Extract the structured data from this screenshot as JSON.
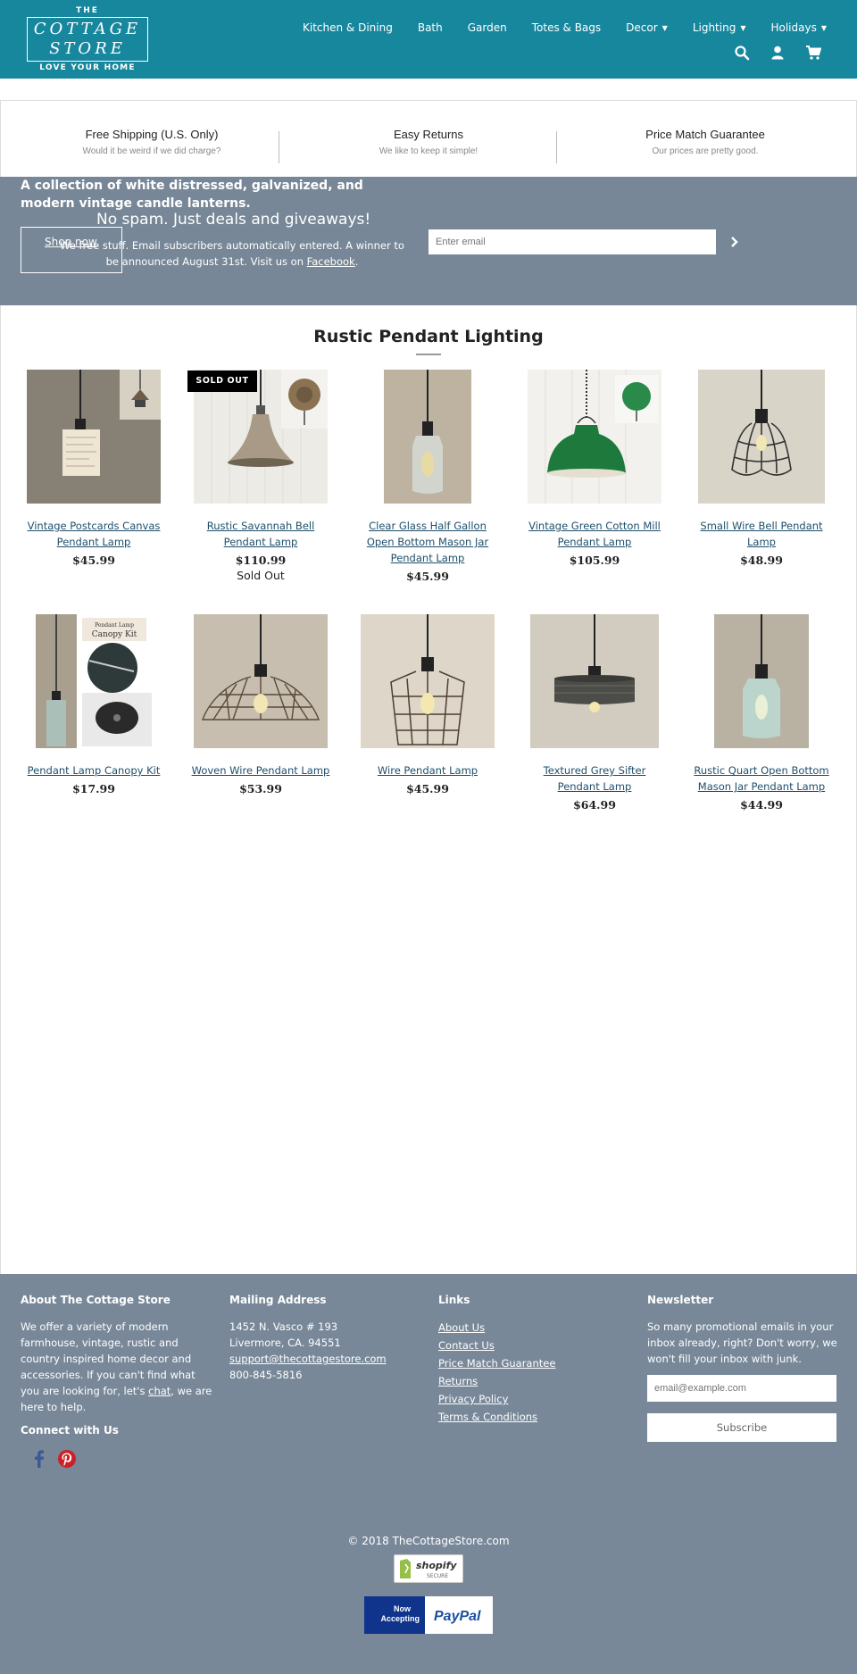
{
  "header": {
    "logo": {
      "the": "THE",
      "line1": "COTTAGE",
      "line2": "STORE",
      "tagline": "LOVE YOUR HOME"
    },
    "nav": [
      {
        "label": "Kitchen & Dining"
      },
      {
        "label": "Bath"
      },
      {
        "label": "Garden"
      },
      {
        "label": "Totes & Bags"
      },
      {
        "label": "Decor",
        "dropdown": true
      },
      {
        "label": "Lighting",
        "dropdown": true
      },
      {
        "label": "Holidays",
        "dropdown": true
      }
    ],
    "icons": [
      "search-icon",
      "user-icon",
      "cart-icon"
    ]
  },
  "usp": [
    {
      "title": "Free Shipping (U.S. Only)",
      "subtitle": "Would it be weird if we did charge?"
    },
    {
      "title": "Easy Returns",
      "subtitle": "We like to keep it simple!"
    },
    {
      "title": "Price Match Guarantee",
      "subtitle": "Our prices are pretty good."
    }
  ],
  "banner": {
    "collection_text": "A collection of white distressed, galvanized, and modern vintage candle lanterns.",
    "shop_now": "Shop now",
    "newsletter_title": "No spam. Just deals and giveaways!",
    "newsletter_text": "We free stuff. Email subscribers automatically entered. A winner to be announced August 31st. Visit us on ",
    "newsletter_link": "Facebook",
    "newsletter_end": ".",
    "email_placeholder": "Enter email"
  },
  "collection": {
    "title": "Rustic Pendant Lighting",
    "sold_out_badge": "SOLD OUT",
    "products": [
      {
        "name": "Vintage Postcards Canvas Pendant Lamp",
        "price": "$45.99"
      },
      {
        "name": "Rustic Savannah Bell Pendant Lamp",
        "price": "$110.99",
        "status": "Sold Out"
      },
      {
        "name": "Clear Glass Half Gallon Open Bottom Mason Jar Pendant Lamp",
        "price": "$45.99"
      },
      {
        "name": "Vintage Green Cotton Mill Pendant Lamp",
        "price": "$105.99"
      },
      {
        "name": "Small Wire Bell Pendant Lamp",
        "price": "$48.99"
      },
      {
        "name": "Pendant Lamp Canopy Kit",
        "price": "$17.99",
        "kit_label_1": "Pendant Lamp",
        "kit_label_2": "Canopy Kit"
      },
      {
        "name": "Woven Wire Pendant Lamp",
        "price": "$53.99"
      },
      {
        "name": "Wire Pendant Lamp",
        "price": "$45.99"
      },
      {
        "name": "Textured Grey Sifter Pendant Lamp",
        "price": "$64.99"
      },
      {
        "name": "Rustic Quart Open Bottom Mason Jar Pendant Lamp",
        "price": "$44.99"
      }
    ]
  },
  "footer": {
    "about": {
      "title": "About The Cottage Store",
      "text": "We offer a variety of modern farmhouse, vintage, rustic and country inspired home decor and accessories. If you can't find what you are looking for, let's ",
      "chat_link": "chat",
      "text_end": ", we are here to help."
    },
    "connect_title": "Connect with Us",
    "mailing": {
      "title": "Mailing Address",
      "line1": "1452 N. Vasco # 193",
      "line2": "Livermore, CA. 94551",
      "email": "support@thecottagestore.com",
      "phone": "800-845-5816"
    },
    "links": {
      "title": "Links",
      "items": [
        "About Us",
        "Contact Us",
        "Price Match Guarantee",
        "Returns",
        "Privacy Policy",
        "Terms & Conditions"
      ]
    },
    "newsletter": {
      "title": "Newsletter",
      "text": "So many promotional emails in your inbox already, right? Don't worry, we won't fill your inbox with junk.",
      "placeholder": "email@example.com",
      "subscribe": "Subscribe"
    },
    "copyright": "© 2018 TheCottageStore.com",
    "shopify": {
      "brand": "shopify",
      "secure": "SECURE"
    },
    "paypal": {
      "now": "Now",
      "accepting": "Accepting",
      "brand": "PayPal"
    }
  },
  "colors": {
    "header": "#17879e",
    "banner": "#778797",
    "footer": "#788899",
    "link": "#1e4f6b"
  }
}
